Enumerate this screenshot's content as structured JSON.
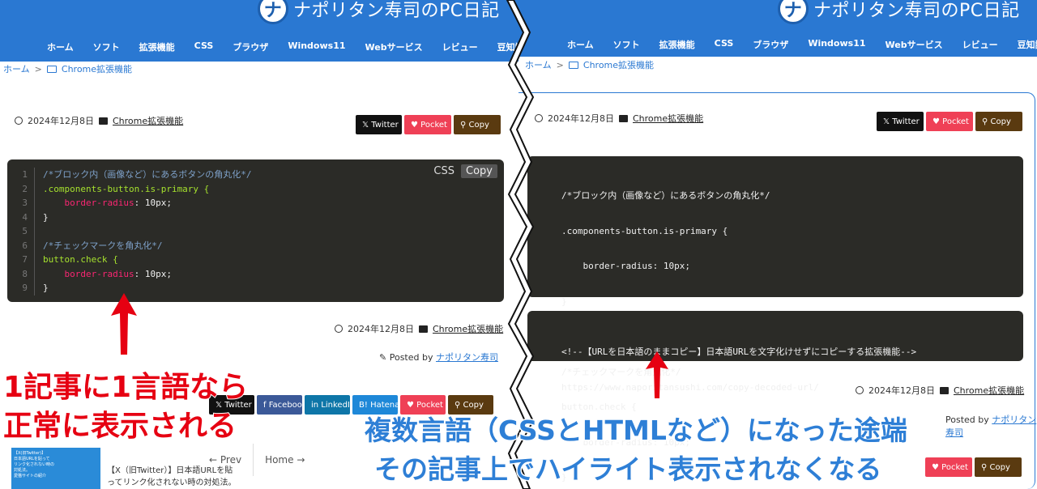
{
  "site_title": "ナポリタン寿司のPC日記",
  "nav": [
    "ホーム",
    "ソフト",
    "拡張機能",
    "CSS",
    "ブラウザ",
    "Windows11",
    "Webサービス",
    "レビュー",
    "豆知識系"
  ],
  "breadcrumb": {
    "home": "ホーム",
    "sep": ">",
    "category": "Chrome拡張機能"
  },
  "meta": {
    "date": "2024年12月8日",
    "category": "Chrome拡張機能"
  },
  "share": {
    "twitter": "Twitter",
    "pocket": "Pocket",
    "copy": "Copy",
    "facebook": "Facebook",
    "linkedin": "LinkedIn",
    "hatena": "Hatena"
  },
  "left_code": {
    "lang": "CSS",
    "copy": "Copy",
    "line_numbers": [
      "1",
      "2",
      "3",
      "4",
      "5",
      "6",
      "7",
      "8",
      "9"
    ],
    "lines": [
      {
        "type": "com",
        "text": "/*ブロック内（画像など）にあるボタンの角丸化*/"
      },
      {
        "type": "sel",
        "text": ".components-button.is-primary {"
      },
      {
        "type": "prop",
        "prop": "    border-radius",
        "val": ": 10px;"
      },
      {
        "type": "plain",
        "text": "}"
      },
      {
        "type": "plain",
        "text": ""
      },
      {
        "type": "com",
        "text": "/*チェックマークを角丸化*/"
      },
      {
        "type": "sel",
        "text": "button.check {"
      },
      {
        "type": "prop",
        "prop": "    border-radius",
        "val": ": 10px;"
      },
      {
        "type": "plain",
        "text": "}"
      }
    ]
  },
  "right_code1": [
    "/*ブロック内（画像など）にあるボタンの角丸化*/",
    ".components-button.is-primary {",
    "    border-radius: 10px;",
    "}",
    "",
    "/*チェックマークを角丸化*/",
    "button.check {",
    "    border-radius: 10px;",
    "}"
  ],
  "right_code2": [
    "<!--【URLを日本語のままコピー】日本語URLを文字化けせずにコピーする拡張機能-->",
    "https://www.naporitansushi.com/copy-decoded-url/"
  ],
  "posted": {
    "prefix": "Posted by",
    "author": "ナポリタン寿司"
  },
  "post_nav": {
    "prev": "Prev",
    "home": "Home"
  },
  "related": {
    "text1": "【X（旧Twitter）】日本語URLを貼",
    "text2": "ってリンク化されない時の対処法。"
  },
  "thumb_text": [
    "【X(旧Twitter)】",
    "日本語URLを貼って",
    "リンク化されない時の",
    "対処法。",
    "愛猫サイトの紹介"
  ],
  "overlay_left": [
    "1記事に1言語なら",
    "正常に表示される"
  ],
  "overlay_right": [
    "複数言語（CSSとHTMLなど）になった途端",
    "その記事上でハイライト表示されなくなる"
  ],
  "colors": {
    "header": "#2a78d2",
    "code_bg": "#2b2b27",
    "overlay_red": "#e60012",
    "overlay_blue": "#2e7fd6"
  }
}
